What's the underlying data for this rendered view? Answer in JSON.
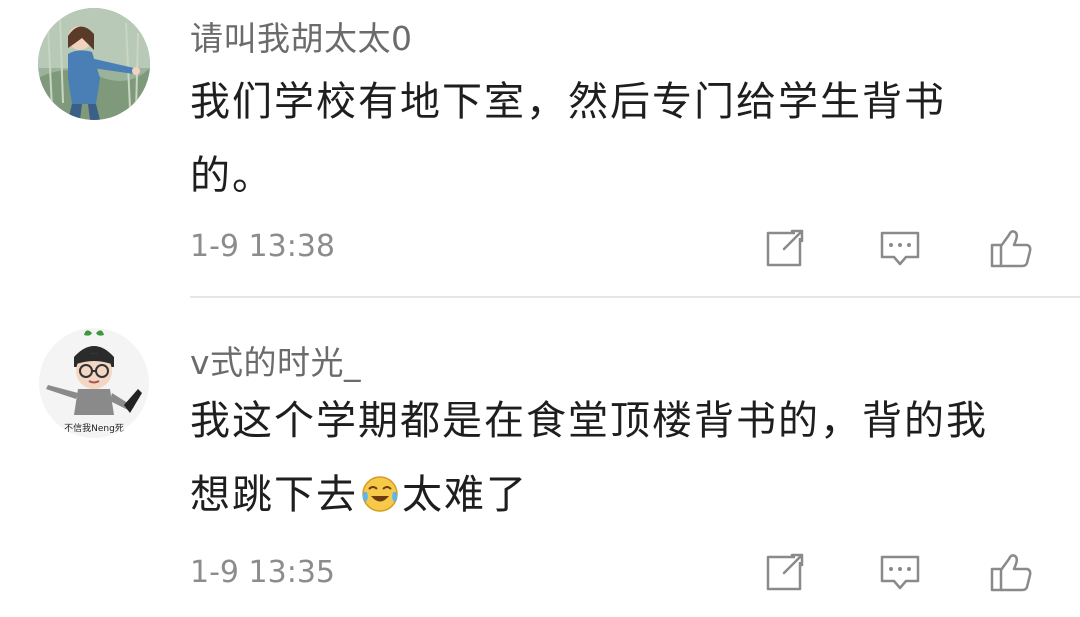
{
  "comments": [
    {
      "username": "请叫我胡太太0",
      "text": "我们学校有地下室，然后专门给学生背书的。",
      "time": "1-9 13:38",
      "avatar_icon": "girl-photo-avatar",
      "actions": [
        "share-icon",
        "comment-icon",
        "like-icon"
      ]
    },
    {
      "username": "v式的时光_",
      "text_before_emoji": "我这个学期都是在食堂顶楼背书的，背的我想跳下去",
      "emoji": "laughing-crying-emoji",
      "text_after_emoji": "太难了",
      "time": "1-9 13:35",
      "avatar_icon": "cartoon-boy-avatar",
      "avatar_caption": "不信我Neng死",
      "actions": [
        "share-icon",
        "comment-icon",
        "like-icon"
      ]
    }
  ],
  "colors": {
    "username": "#6b6b6b",
    "text": "#1e1e1e",
    "time": "#8c8c8c",
    "icon": "#8a8a8a",
    "divider": "#e6e6e6"
  }
}
